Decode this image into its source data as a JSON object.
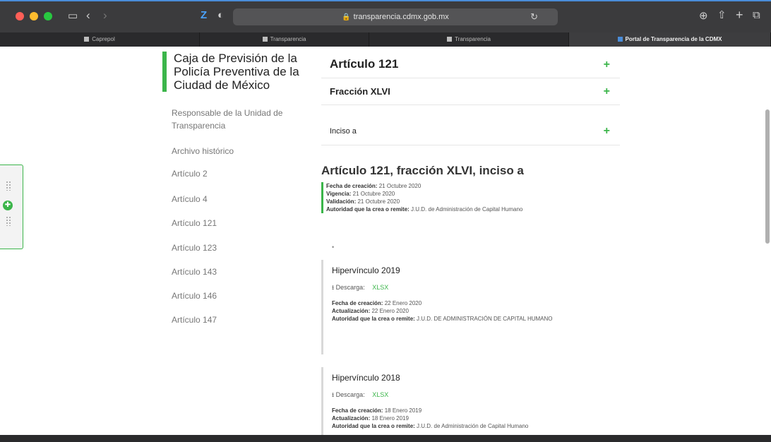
{
  "browser": {
    "url": "transparencia.cdmx.gob.mx",
    "tabs": [
      "Caprepol",
      "Transparencia",
      "Transparencia",
      "Portal de Transparencia de la CDMX"
    ],
    "colors": {
      "close": "#ff5f57",
      "minimize": "#febc2e",
      "maximize": "#28c840"
    }
  },
  "sidebar": {
    "title": "Caja de Previsión de la Policía Preventiva de la Ciudad de México",
    "items": [
      "Responsable de la Unidad de Transparencia",
      "Archivo histórico",
      "Artículo 2",
      "Artículo 4",
      "Artículo 121",
      "Artículo 123",
      "Artículo 143",
      "Artículo 146",
      "Artículo 147"
    ]
  },
  "accordions": {
    "articulo": "Artículo 121",
    "fraccion": "Fracción XLVI",
    "inciso": "Inciso a",
    "plus": "+"
  },
  "section": {
    "title": "Artículo 121, fracción XLVI, inciso a",
    "fecha_label": "Fecha de creación:",
    "fecha": "21 Octubre 2020",
    "vigencia_label": "Vigencia:",
    "vigencia": "21 Octubre 2020",
    "validacion_label": "Validación:",
    "validacion": "21 Octubre 2020",
    "autoridad_label": "Autoridad que la crea o remite:",
    "autoridad": "J.U.D. de Administración de Capital Humano",
    "dot": "•"
  },
  "cards": [
    {
      "title": "Hipervínculo 2019",
      "download_label": "Descarga:",
      "format": "XLSX",
      "fecha_label": "Fecha de creación:",
      "fecha": "22 Enero 2020",
      "actualizacion_label": "Actualización:",
      "actualizacion": "22 Enero 2020",
      "autoridad_label": "Autoridad que la crea o remite:",
      "autoridad": "J.U.D. DE ADMINISTRACIÓN DE CAPITAL HUMANO"
    },
    {
      "title": "Hipervínculo 2018",
      "download_label": "Descarga:",
      "format": "XLSX",
      "fecha_label": "Fecha de creación:",
      "fecha": "18 Enero 2019",
      "actualizacion_label": "Actualización:",
      "actualizacion": "18 Enero 2019",
      "autoridad_label": "Autoridad que la crea o remite:",
      "autoridad": "J.U.D. de Administración de Capital Humano"
    }
  ],
  "accent_color": "#3bb54a"
}
